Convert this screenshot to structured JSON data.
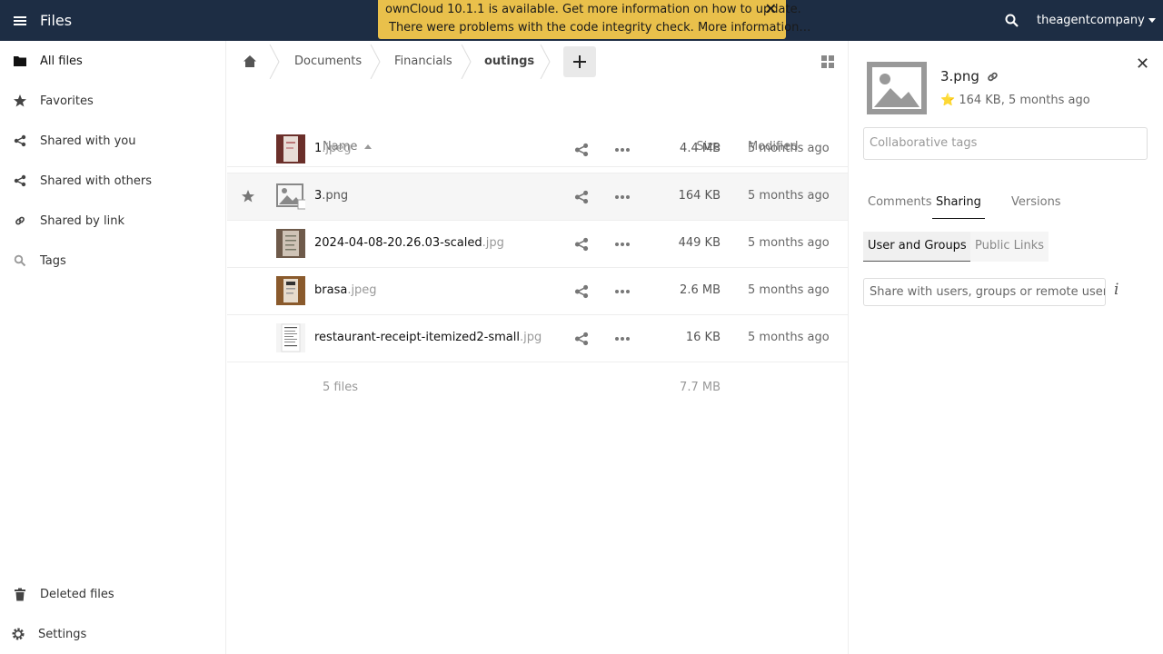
{
  "header": {
    "app_title": "Files",
    "user": "theagentcompany",
    "banner_line1": "ownCloud 10.1.1 is available. Get more information on how to update.",
    "banner_line2": "There were problems with the code integrity check. More information…"
  },
  "sidebar": {
    "items": [
      {
        "label": "All files",
        "icon": "folder-icon"
      },
      {
        "label": "Favorites",
        "icon": "star-icon"
      },
      {
        "label": "Shared with you",
        "icon": "share-icon"
      },
      {
        "label": "Shared with others",
        "icon": "share-icon"
      },
      {
        "label": "Shared by link",
        "icon": "link-icon"
      },
      {
        "label": "Tags",
        "icon": "tag-icon"
      }
    ],
    "deleted_files": "Deleted files",
    "settings": "Settings"
  },
  "breadcrumb": [
    "Documents",
    "Financials",
    "outings"
  ],
  "table": {
    "col_name": "Name",
    "col_size": "Size",
    "col_modified": "Modified",
    "rows": [
      {
        "name": "1",
        "ext": ".jpeg",
        "size": "4.4 MB",
        "modified": "5 months ago"
      },
      {
        "name": "3",
        "ext": ".png",
        "size": "164 KB",
        "modified": "5 months ago"
      },
      {
        "name": "2024-04-08-20.26.03-scaled",
        "ext": ".jpg",
        "size": "449 KB",
        "modified": "5 months ago"
      },
      {
        "name": "brasa",
        "ext": ".jpeg",
        "size": "2.6 MB",
        "modified": "5 months ago"
      },
      {
        "name": "restaurant-receipt-itemized2-small",
        "ext": ".jpg",
        "size": "16 KB",
        "modified": "5 months ago"
      }
    ],
    "summary_count": "5 files",
    "summary_size": "7.7 MB"
  },
  "details": {
    "filename": "3.png",
    "meta": "164 KB, 5 months ago",
    "tags_placeholder": "Collaborative tags",
    "tabs": [
      "Comments",
      "Sharing",
      "Versions"
    ],
    "subtabs": [
      "User and Groups",
      "Public Links"
    ],
    "share_placeholder": "Share with users, groups or remote users…",
    "info_glyph": "i"
  },
  "colors": {
    "header_bg": "#1d2d44",
    "banner_bg": "#e9c04b"
  }
}
